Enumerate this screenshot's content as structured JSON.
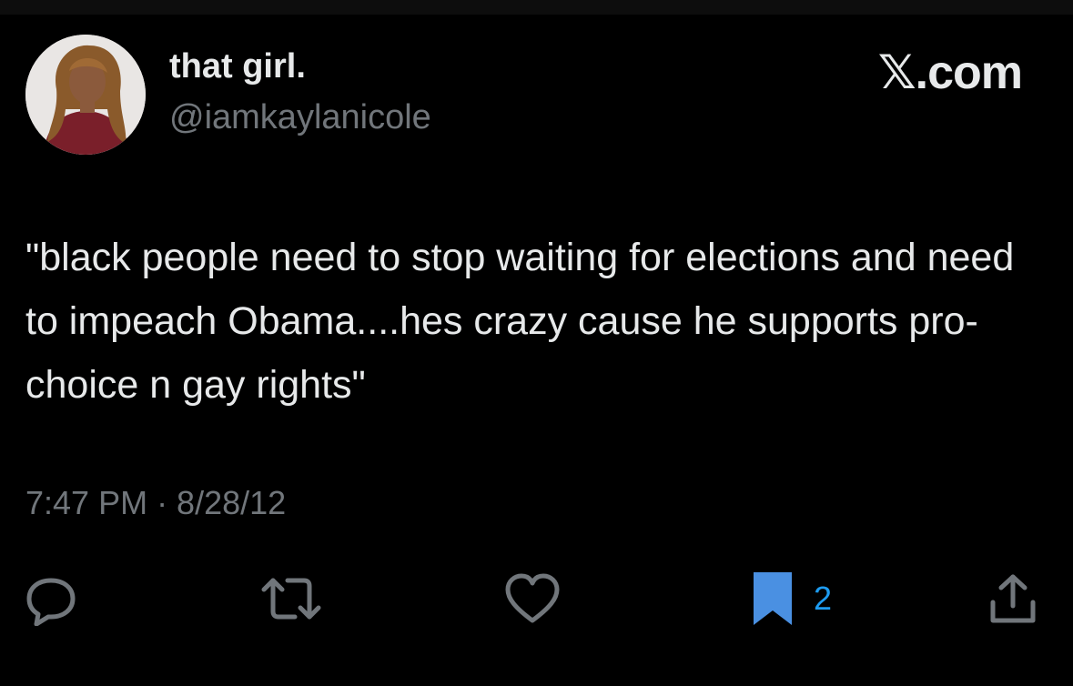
{
  "author": {
    "display_name": "that girl.",
    "handle": "@iamkaylanicole",
    "avatar_icon": "profile-photo"
  },
  "brand": {
    "label": "𝕏.com"
  },
  "tweet": {
    "text": "\"black people need to stop waiting for elections and need to impeach Obama....hes crazy cause he supports pro-choice n gay rights\"",
    "timestamp": "7:47 PM · 8/28/12"
  },
  "actions": {
    "reply": {
      "icon": "reply-icon"
    },
    "retweet": {
      "icon": "retweet-icon"
    },
    "like": {
      "icon": "heart-icon"
    },
    "bookmark": {
      "icon": "bookmark-icon",
      "count": "2",
      "active": true
    },
    "share": {
      "icon": "share-icon"
    }
  },
  "colors": {
    "background": "#000000",
    "text_primary": "#e7e9ea",
    "text_secondary": "#71767b",
    "accent": "#1d9bf0",
    "bookmark_fill": "#4a90e2"
  }
}
